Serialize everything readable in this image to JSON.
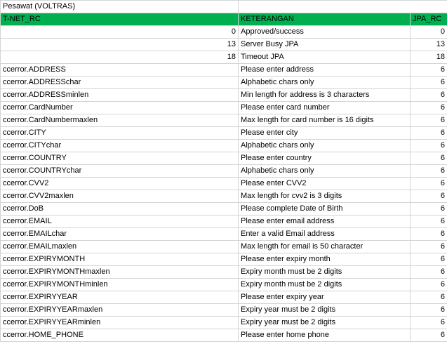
{
  "sheet": {
    "title": "Pesawat (VOLTRAS)",
    "header": {
      "col1": "T-NET_RC",
      "col2": "KETERANGAN",
      "col3": "JPA_RC"
    },
    "rows": [
      {
        "rc": "",
        "rc_num": "0",
        "keterangan": "Approved/success",
        "jpa": "0"
      },
      {
        "rc": "",
        "rc_num": "13",
        "keterangan": "Server Busy JPA",
        "jpa": "13"
      },
      {
        "rc": "",
        "rc_num": "18",
        "keterangan": "Timeout JPA",
        "jpa": "18"
      },
      {
        "rc": "ccerror.ADDRESS",
        "rc_num": "",
        "keterangan": "Please enter address",
        "jpa": "6"
      },
      {
        "rc": "ccerror.ADDRESSchar",
        "rc_num": "",
        "keterangan": "Alphabetic chars only",
        "jpa": "6"
      },
      {
        "rc": "ccerror.ADDRESSminlen",
        "rc_num": "",
        "keterangan": "Min length for address is 3 characters",
        "jpa": "6"
      },
      {
        "rc": "ccerror.CardNumber",
        "rc_num": "",
        "keterangan": "Please enter card number",
        "jpa": "6"
      },
      {
        "rc": "ccerror.CardNumbermaxlen",
        "rc_num": "",
        "keterangan": "Max length for card number is 16 digits",
        "jpa": "6"
      },
      {
        "rc": "ccerror.CITY",
        "rc_num": "",
        "keterangan": "Please enter city",
        "jpa": "6"
      },
      {
        "rc": "ccerror.CITYchar",
        "rc_num": "",
        "keterangan": "Alphabetic chars only",
        "jpa": "6"
      },
      {
        "rc": "ccerror.COUNTRY",
        "rc_num": "",
        "keterangan": "Please enter country",
        "jpa": "6"
      },
      {
        "rc": "ccerror.COUNTRYchar",
        "rc_num": "",
        "keterangan": "Alphabetic chars only",
        "jpa": "6"
      },
      {
        "rc": "ccerror.CVV2",
        "rc_num": "",
        "keterangan": "Please enter CVV2",
        "jpa": "6"
      },
      {
        "rc": "ccerror.CVV2maxlen",
        "rc_num": "",
        "keterangan": "Max length for cvv2 is 3 digits",
        "jpa": "6"
      },
      {
        "rc": "ccerror.DoB",
        "rc_num": "",
        "keterangan": "Please complete Date of Birth",
        "jpa": "6"
      },
      {
        "rc": "ccerror.EMAIL",
        "rc_num": "",
        "keterangan": "Please enter email address",
        "jpa": "6"
      },
      {
        "rc": "ccerror.EMAILchar",
        "rc_num": "",
        "keterangan": "Enter a valid Email address",
        "jpa": "6"
      },
      {
        "rc": "ccerror.EMAILmaxlen",
        "rc_num": "",
        "keterangan": "Max length for email is 50 character",
        "jpa": "6"
      },
      {
        "rc": "ccerror.EXPIRYMONTH",
        "rc_num": "",
        "keterangan": "Please enter expiry month",
        "jpa": "6"
      },
      {
        "rc": "ccerror.EXPIRYMONTHmaxlen",
        "rc_num": "",
        "keterangan": "Expiry month must be 2 digits",
        "jpa": "6"
      },
      {
        "rc": "ccerror.EXPIRYMONTHminlen",
        "rc_num": "",
        "keterangan": "Expiry month must be 2 digits",
        "jpa": "6"
      },
      {
        "rc": "ccerror.EXPIRYYEAR",
        "rc_num": "",
        "keterangan": "Please enter expiry year",
        "jpa": "6"
      },
      {
        "rc": "ccerror.EXPIRYYEARmaxlen",
        "rc_num": "",
        "keterangan": "Expiry year must be 2 digits",
        "jpa": "6"
      },
      {
        "rc": "ccerror.EXPIRYYEARminlen",
        "rc_num": "",
        "keterangan": "Expiry year must be 2 digits",
        "jpa": "6"
      },
      {
        "rc": "ccerror.HOME_PHONE",
        "rc_num": "",
        "keterangan": "Please enter home phone",
        "jpa": "6"
      }
    ]
  },
  "colors": {
    "header_fill": "#00b050",
    "gridline": "#d4d4d4"
  }
}
